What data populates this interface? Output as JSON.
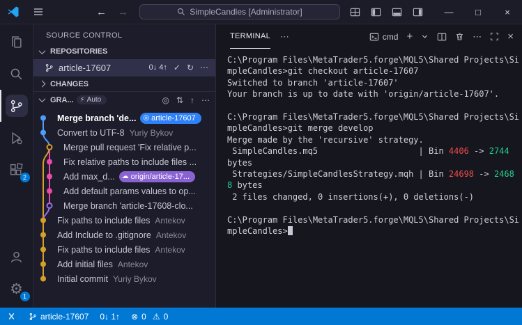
{
  "colors": {
    "accent": "#0078d4",
    "terminal": {
      "red": "#f14c4c",
      "green": "#23d18b"
    },
    "graph": {
      "blue": "#4f9cf9",
      "yellow": "#d6a028",
      "pink": "#ea4aaa",
      "purple": "#9a6ff0"
    },
    "badge_head_bg": "#2f81f7",
    "badge_remote_bg": "#8a63d2"
  },
  "glyphs": {
    "back": "←",
    "forward": "→",
    "minimize": "—",
    "maximize": "□",
    "close": "×",
    "more": "⋯",
    "plus": "+",
    "check": "✓",
    "refresh": "↻",
    "target": "◎",
    "swap": "⇅",
    "arrow_up": "↑",
    "lightning": "⚡",
    "error": "⊗",
    "warning": "⚠",
    "gear": "⚙"
  },
  "title_bar": {
    "title": "SimpleCandles [Administrator]"
  },
  "activity_bar": {
    "items": [
      {
        "label": "Explorer"
      },
      {
        "label": "Search"
      },
      {
        "label": "Source Control",
        "active": true
      },
      {
        "label": "Run and Debug"
      },
      {
        "label": "Extensions",
        "badge": "2"
      }
    ],
    "bottom_items": [
      {
        "label": "Accounts"
      },
      {
        "label": "Settings",
        "badge": "1"
      }
    ]
  },
  "sidebar": {
    "title": "SOURCE CONTROL",
    "repositories": {
      "label": "REPOSITORIES",
      "repo_name": "article-17607",
      "sync_counts": "0↓ 4↑"
    },
    "changes": {
      "label": "CHANGES"
    },
    "graph": {
      "label": "GRA...",
      "auto_label": "Auto",
      "commits": [
        {
          "label": "Merge branch 'de...",
          "badge": "article-17607",
          "badge_type": "head",
          "color": "blue",
          "lane": 0,
          "bold": true,
          "shape": "dot"
        },
        {
          "label": "Convert to UTF-8",
          "author": "Yuriy Bykov",
          "color": "blue",
          "lane": 0,
          "shape": "dot"
        },
        {
          "label": "Merge pull request 'Fix relative p...",
          "color": "yellow",
          "lane": 1,
          "shape": "ring"
        },
        {
          "label": "Fix relative paths to include files ...",
          "color": "pink",
          "lane": 1,
          "shape": "dot"
        },
        {
          "label": "Add max_d...",
          "badge": "origin/article-17...",
          "badge_type": "remote",
          "color": "pink",
          "lane": 1,
          "shape": "dot"
        },
        {
          "label": "Add default params values to op...",
          "color": "pink",
          "lane": 1,
          "shape": "dot"
        },
        {
          "label": "Merge branch 'article-17608-clo...",
          "color": "purple",
          "lane": 1,
          "shape": "ring"
        },
        {
          "label": "Fix paths to include files",
          "author": "Antekov",
          "color": "yellow",
          "lane": 0,
          "shape": "dot"
        },
        {
          "label": "Add Include to .gitignore",
          "author": "Antekov",
          "color": "yellow",
          "lane": 0,
          "shape": "dot"
        },
        {
          "label": "Fix paths to include files",
          "author": "Antekov",
          "color": "yellow",
          "lane": 0,
          "shape": "dot"
        },
        {
          "label": "Add initial files",
          "author": "Antekov",
          "color": "yellow",
          "lane": 0,
          "shape": "dot"
        },
        {
          "label": "Initial commit",
          "author": "Yuriy Bykov",
          "color": "yellow",
          "lane": 0,
          "shape": "dot"
        }
      ]
    }
  },
  "terminal": {
    "tab": "TERMINAL",
    "shell_label": "cmd",
    "cursor": true,
    "lines": [
      [
        {
          "t": "C:\\Program Files\\MetaTrader5.forge\\MQL5\\Shared Projects\\SimpleCandles>git checkout article-17607"
        }
      ],
      [
        {
          "t": "Switched to branch 'article-17607'"
        }
      ],
      [
        {
          "t": "Your branch is up to date with 'origin/article-17607'."
        }
      ],
      [],
      [
        {
          "t": "C:\\Program Files\\MetaTrader5.forge\\MQL5\\Shared Projects\\SimpleCandles>git merge develop"
        }
      ],
      [
        {
          "t": "Merge made by the 'recursive' strategy."
        }
      ],
      [
        {
          "t": " SimpleCandles.mq5                    | Bin "
        },
        {
          "t": "4406",
          "c": "red"
        },
        {
          "t": " -> "
        },
        {
          "t": "2744",
          "c": "green"
        },
        {
          "t": " bytes"
        }
      ],
      [
        {
          "t": " Strategies/SimpleCandlesStrategy.mqh | Bin "
        },
        {
          "t": "24698",
          "c": "red"
        },
        {
          "t": " -> "
        },
        {
          "t": "24688",
          "c": "green"
        },
        {
          "t": " bytes"
        }
      ],
      [
        {
          "t": " 2 files changed, 0 insertions(+), 0 deletions(-)"
        }
      ],
      [],
      [
        {
          "t": "C:\\Program Files\\MetaTrader5.forge\\MQL5\\Shared Projects\\SimpleCandles>"
        }
      ]
    ]
  },
  "status_bar": {
    "branch": "article-17607",
    "sync": "0↓ 1↑",
    "errors": "0",
    "warnings": "0"
  }
}
